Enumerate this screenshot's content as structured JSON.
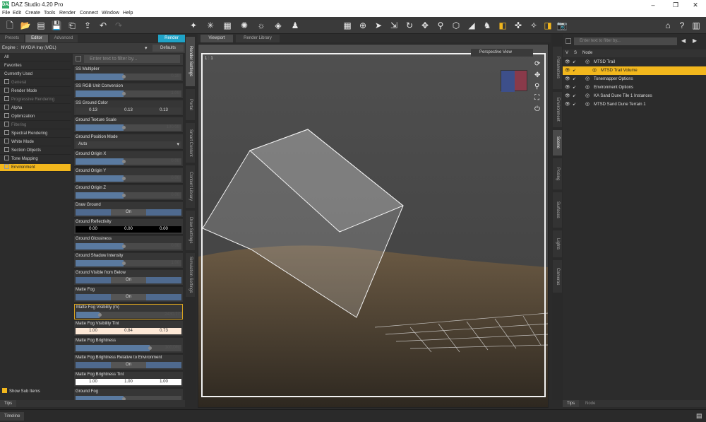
{
  "window": {
    "title": "DAZ Studio 4.20 Pro",
    "logo": "DAZ"
  },
  "menu": [
    "File",
    "Edit",
    "Create",
    "Tools",
    "Render",
    "Connect",
    "Window",
    "Help"
  ],
  "toolbar_icons": [
    "new-icon",
    "open-icon",
    "folder-icon",
    "save-icon",
    "merge-icon",
    "export-icon",
    "undo-icon",
    "redo-icon"
  ],
  "left_tabs": {
    "presets": "Presets",
    "editor": "Editor",
    "advanced": "Advanced",
    "render": "Render"
  },
  "engine": {
    "label": "Engine :",
    "value": "NVIDIA Iray (MDL)",
    "defaults": "Defaults"
  },
  "filter_placeholder": "Enter text to filter by...",
  "nav": [
    {
      "label": "All",
      "state": "normal"
    },
    {
      "label": "Favorites",
      "state": "normal"
    },
    {
      "label": "Currently Used",
      "state": "normal"
    },
    {
      "label": "General",
      "state": "dim"
    },
    {
      "label": "Render Mode",
      "state": "normal"
    },
    {
      "label": "Progressive Rendering",
      "state": "dim"
    },
    {
      "label": "Alpha",
      "state": "normal"
    },
    {
      "label": "Optimization",
      "state": "normal"
    },
    {
      "label": "Filtering",
      "state": "dim"
    },
    {
      "label": "Spectral Rendering",
      "state": "normal"
    },
    {
      "label": "White Mode",
      "state": "normal"
    },
    {
      "label": "Section Objects",
      "state": "normal"
    },
    {
      "label": "Tone Mapping",
      "state": "normal"
    },
    {
      "label": "Environment",
      "state": "sel"
    }
  ],
  "show_sub_items": "Show Sub Items",
  "props": [
    {
      "label": "SS Multiplier",
      "kind": "slider",
      "value": "0.10",
      "level": 0.45
    },
    {
      "label": "SS RGB Unit Conversion",
      "kind": "slider",
      "value": "1.00",
      "level": 0.45
    },
    {
      "label": "SS Ground Color",
      "kind": "color",
      "vals": [
        "0.13",
        "0.13",
        "0.13"
      ]
    },
    {
      "label": "Ground Texture Scale",
      "kind": "slider",
      "value": "100.00",
      "level": 0.45
    },
    {
      "label": "Ground Position Mode",
      "kind": "select",
      "value": "Auto"
    },
    {
      "label": "Ground Origin X",
      "kind": "slider",
      "value": "0.00",
      "level": 0.45
    },
    {
      "label": "Ground Origin Y",
      "kind": "slider",
      "value": "0.00",
      "level": 0.45
    },
    {
      "label": "Ground Origin Z",
      "kind": "slider",
      "value": "0.00",
      "level": 0.45
    },
    {
      "label": "Draw Ground",
      "kind": "toggle",
      "value": "On"
    },
    {
      "label": "Ground Reflectivity",
      "kind": "black",
      "vals": [
        "0.00",
        "0.00",
        "0.00"
      ]
    },
    {
      "label": "Ground Glossiness",
      "kind": "slider",
      "value": "0.00",
      "level": 0.45
    },
    {
      "label": "Ground Shadow Intensity",
      "kind": "slider",
      "value": "1.00",
      "level": 0.45
    },
    {
      "label": "Ground Visible from Below",
      "kind": "toggle",
      "value": "On"
    },
    {
      "label": "Matte Fog",
      "kind": "toggle",
      "value": "On"
    },
    {
      "label": "Matte Fog Visibility (m)",
      "kind": "slider",
      "value": "2430.77",
      "level": 0.22,
      "hl": true
    },
    {
      "label": "Matte Fog Visibility Tint",
      "kind": "tint",
      "vals": [
        "1.00",
        "0.84",
        "0.73"
      ]
    },
    {
      "label": "Matte Fog Brightness",
      "kind": "slider",
      "value": "100.0%",
      "level": 0.7
    },
    {
      "label": "Matte Fog Brightness Relative to Environment",
      "kind": "toggle",
      "value": "On"
    },
    {
      "label": "Matte Fog Brightness Tint",
      "kind": "white",
      "vals": [
        "1.00",
        "1.00",
        "1.00"
      ]
    },
    {
      "label": "Ground Fog",
      "kind": "slider",
      "value": "",
      "level": 0.45
    }
  ],
  "left_vtabs": [
    "Render Settings",
    "Portal",
    "Smart Content",
    "Content Library",
    "Draw Settings",
    "Simulation Settings"
  ],
  "view_tabs": {
    "viewport": "Viewport",
    "render_library": "Render Library"
  },
  "viewport": {
    "camera": "Perspective View",
    "ratio": "1 : 1"
  },
  "right_vtabs": [
    "Parameters",
    "Environment",
    "Scene",
    "Posing",
    "Surfaces",
    "Lights",
    "Cameras"
  ],
  "scene": {
    "filter": "Enter text to filter by...",
    "col_v": "V",
    "col_s": "S",
    "col_node": "Node",
    "nodes": [
      {
        "label": "MTSD Trail",
        "depth": 0,
        "sel": false
      },
      {
        "label": "MTSD Trail Volume",
        "depth": 1,
        "sel": true
      },
      {
        "label": "Tonemapper Options",
        "depth": 0,
        "sel": false
      },
      {
        "label": "Environment Options",
        "depth": 0,
        "sel": false
      },
      {
        "label": "KA Sand Dune Tile 1 Instances",
        "depth": 0,
        "sel": false
      },
      {
        "label": "MTSD Sand Dune Terrain 1",
        "depth": 0,
        "sel": false
      }
    ]
  },
  "bottom": {
    "tips": "Tips",
    "node": "Node",
    "timeline": "Timeline"
  },
  "colors": {
    "accent": "#f2b71d",
    "render": "#1fa3c7",
    "slider_fill": "#5a7aa0"
  }
}
